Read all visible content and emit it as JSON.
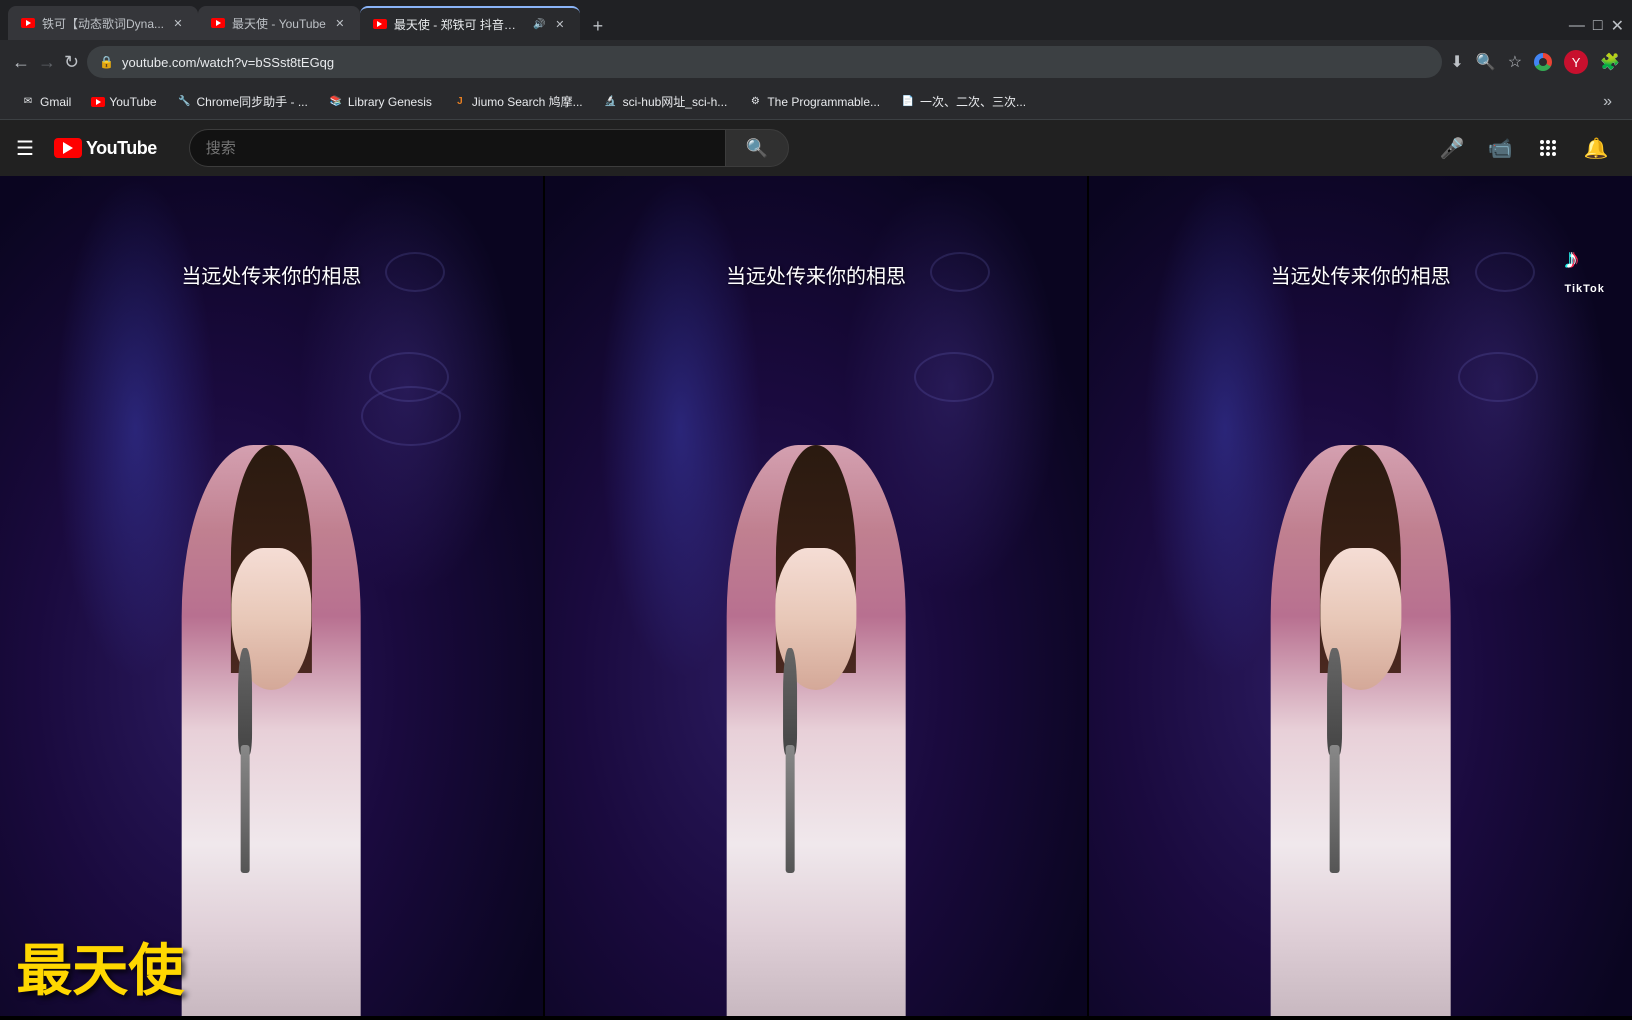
{
  "browser": {
    "tabs": [
      {
        "id": "tab1",
        "title": "铁可【动态歌词Dyna...",
        "favicon_type": "yt",
        "active": false,
        "has_close": true
      },
      {
        "id": "tab2",
        "title": "最天使 - YouTube",
        "favicon_type": "yt",
        "active": false,
        "has_close": true
      },
      {
        "id": "tab3",
        "title": "最天使 - 郑铁可 抖音歌手翻...",
        "favicon_type": "yt",
        "active": true,
        "has_close": true,
        "audio": true
      }
    ],
    "new_tab_label": "+",
    "address": "youtube.com/watch?v=bSSst8tEGqg",
    "controls": {
      "download": "⬇",
      "search": "🔍",
      "star": "☆",
      "chrome_ext": "🧩"
    }
  },
  "bookmarks": [
    {
      "label": "Gmail",
      "favicon": "✉"
    },
    {
      "label": "YouTube",
      "favicon": "▶",
      "type": "yt"
    },
    {
      "label": "Chrome同步助手 - ...",
      "favicon": "🔧"
    },
    {
      "label": "Library Genesis",
      "favicon": "📚"
    },
    {
      "label": "Jiumo Search 鸠摩...",
      "favicon": "J"
    },
    {
      "label": "sci-hub网址_sci-h...",
      "favicon": "🔬"
    },
    {
      "label": "The Programmable...",
      "favicon": "⚙"
    },
    {
      "label": "一次、二次、三次...",
      "favicon": "📄"
    }
  ],
  "youtube": {
    "logo_text": "YouTube",
    "search_placeholder": "搜索",
    "search_button_icon": "🔍",
    "mic_icon": "🎤",
    "camera_icon": "📹",
    "apps_icon": "⊞",
    "bell_icon": "🔔"
  },
  "video": {
    "subtitle_text": "当远处传来你的相思",
    "bottom_text": "最天使",
    "tiktok_brand": "TikTok",
    "panels": 3
  }
}
